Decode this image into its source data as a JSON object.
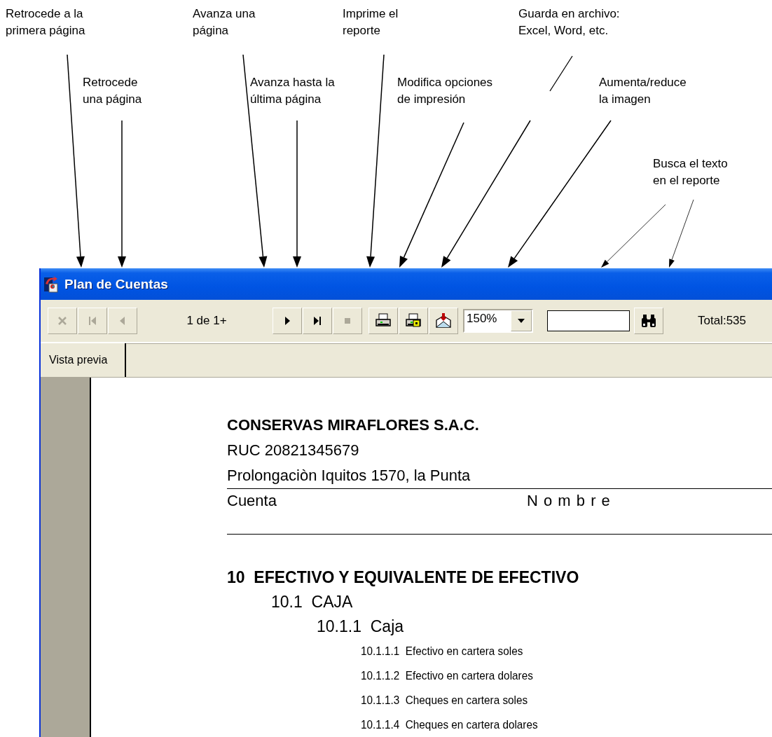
{
  "annotations": [
    {
      "text": "Retrocede a la\nprimera página"
    },
    {
      "text": "Retrocede\nuna página"
    },
    {
      "text": "Avanza una\npágina"
    },
    {
      "text": "Avanza hasta la\núltima página"
    },
    {
      "text": "Imprime el\nreporte"
    },
    {
      "text": "Modifica opciones\nde impresión"
    },
    {
      "text": "Guarda en archivo:\nExcel, Word, etc."
    },
    {
      "text": "Aumenta/reduce\nla imagen"
    },
    {
      "text": "Busca el texto\nen el reporte"
    }
  ],
  "window": {
    "title": "Plan de Cuentas"
  },
  "toolbar": {
    "nav_buttons": [
      {
        "kind": "close",
        "disabled": true
      },
      {
        "kind": "first",
        "disabled": true
      },
      {
        "kind": "prev",
        "disabled": true
      }
    ],
    "page_indicator": "1 de 1+",
    "nav_buttons_2": [
      {
        "kind": "next",
        "disabled": false
      },
      {
        "kind": "last",
        "disabled": false
      },
      {
        "kind": "stop",
        "disabled": true
      }
    ],
    "print_buttons": [
      {
        "kind": "print"
      },
      {
        "kind": "setup"
      },
      {
        "kind": "export"
      }
    ],
    "zoom": {
      "value": "150%"
    },
    "total": "Total:535"
  },
  "tabs": [
    {
      "label": "Vista previa",
      "selected": true
    }
  ],
  "report": {
    "company": "CONSERVAS MIRAFLORES S.A.C.",
    "ruc": "RUC 20821345679",
    "address": "Prolongaciòn Iquitos 1570, la Punta",
    "columns": [
      "Cuenta",
      "N o m b r e"
    ],
    "accounts": [
      {
        "code": "10",
        "name": "EFECTIVO Y EQUIVALENTE DE EFECTIVO",
        "children": [
          {
            "code": "10.1",
            "name": "CAJA",
            "children": [
              {
                "code": "10.1.1",
                "name": "Caja",
                "children": [
                  {
                    "code": "10.1.1.1",
                    "name": "Efectivo en cartera soles"
                  },
                  {
                    "code": "10.1.1.2",
                    "name": "Efectivo en cartera dolares"
                  },
                  {
                    "code": "10.1.1.3",
                    "name": "Cheques en cartera soles"
                  },
                  {
                    "code": "10.1.1.4",
                    "name": "Cheques en cartera dolares"
                  }
                ]
              }
            ]
          }
        ]
      }
    ]
  }
}
